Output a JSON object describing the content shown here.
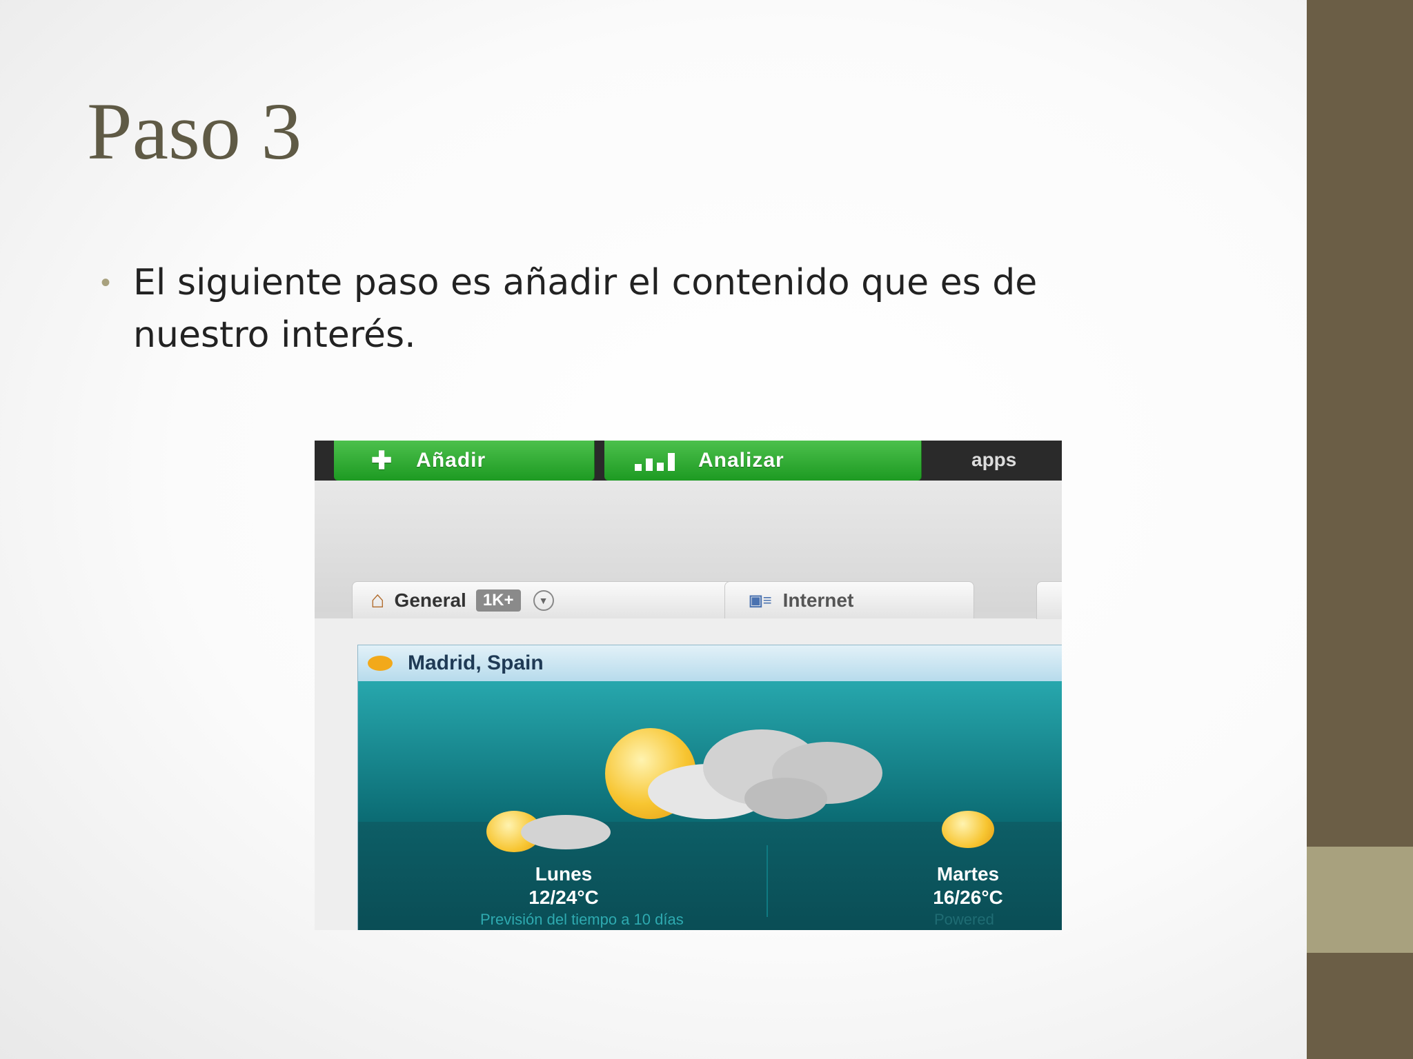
{
  "slide": {
    "title": "Paso 3",
    "bullet": "El siguiente paso es añadir el contenido que es de nuestro interés."
  },
  "screenshot": {
    "menu": {
      "add_label": "Añadir",
      "analyze_label": "Analizar",
      "apps_label": "apps"
    },
    "tabs": [
      {
        "label": "General",
        "badge": "1K+"
      },
      {
        "label": "Internet"
      }
    ],
    "weather": {
      "city": "Madrid, Spain",
      "days": [
        {
          "name": "Lunes",
          "temp": "12/24°C"
        },
        {
          "name": "Martes",
          "temp": "16/26°C"
        }
      ],
      "forecast_link": "Previsión del tiempo a 10 días",
      "powered_partial": "Powered"
    }
  },
  "colors": {
    "title": "#5f5a45",
    "side_bar": "#6b5e46",
    "side_accent": "#a8a17e",
    "menu_green": "#1d9a22",
    "widget_teal": "#0b6b73"
  },
  "icons": [
    "plus-icon",
    "bar-chart-icon",
    "house-icon",
    "chevron-down-icon",
    "internet-icon",
    "sun-icon",
    "cloud-icon"
  ]
}
